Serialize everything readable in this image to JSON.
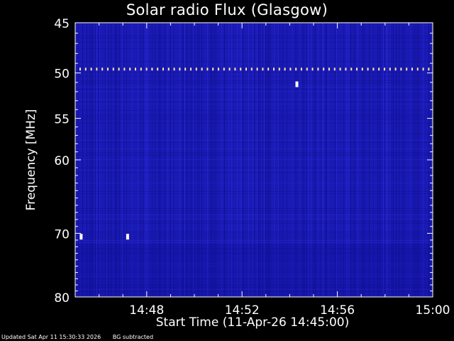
{
  "title": "Solar radio Flux (Glasgow)",
  "footer": {
    "updated": "Updated Sat Apr 11 15:30:33 2026",
    "bg_note": "BG subtracted"
  },
  "colors": {
    "background": "#000000",
    "spectrogram_base": "#1a1ab4",
    "spectrogram_dark": "#0d0d8a",
    "spectrogram_light": "#2a2ad8",
    "burst_white": "#ffffff",
    "burst_yellow": "#ffe6a0",
    "axis": "#ffffff"
  },
  "chart_data": {
    "type": "heatmap",
    "title": "Solar radio Flux (Glasgow)",
    "xlabel": "Start Time (11-Apr-26 14:45:00)",
    "ylabel": "Frequency [MHz]",
    "x_ticks": [
      "14:48",
      "14:52",
      "14:56",
      "15:00"
    ],
    "x_tick_minutes": [
      3,
      7,
      11,
      15
    ],
    "xlim_minutes": [
      0,
      15
    ],
    "y_ticks": [
      45,
      50,
      55,
      60,
      70,
      80
    ],
    "y_scale": "log",
    "ylim": [
      45,
      80
    ],
    "y_axis_direction": "inverted",
    "interference_line_mhz": 49.6,
    "features": [
      {
        "time_min": 0.25,
        "freq_mhz": 70.5,
        "kind": "spike"
      },
      {
        "time_min": 2.2,
        "freq_mhz": 70.5,
        "kind": "spike"
      },
      {
        "time_min": 9.3,
        "freq_mhz": 51.2,
        "kind": "spike"
      }
    ]
  }
}
